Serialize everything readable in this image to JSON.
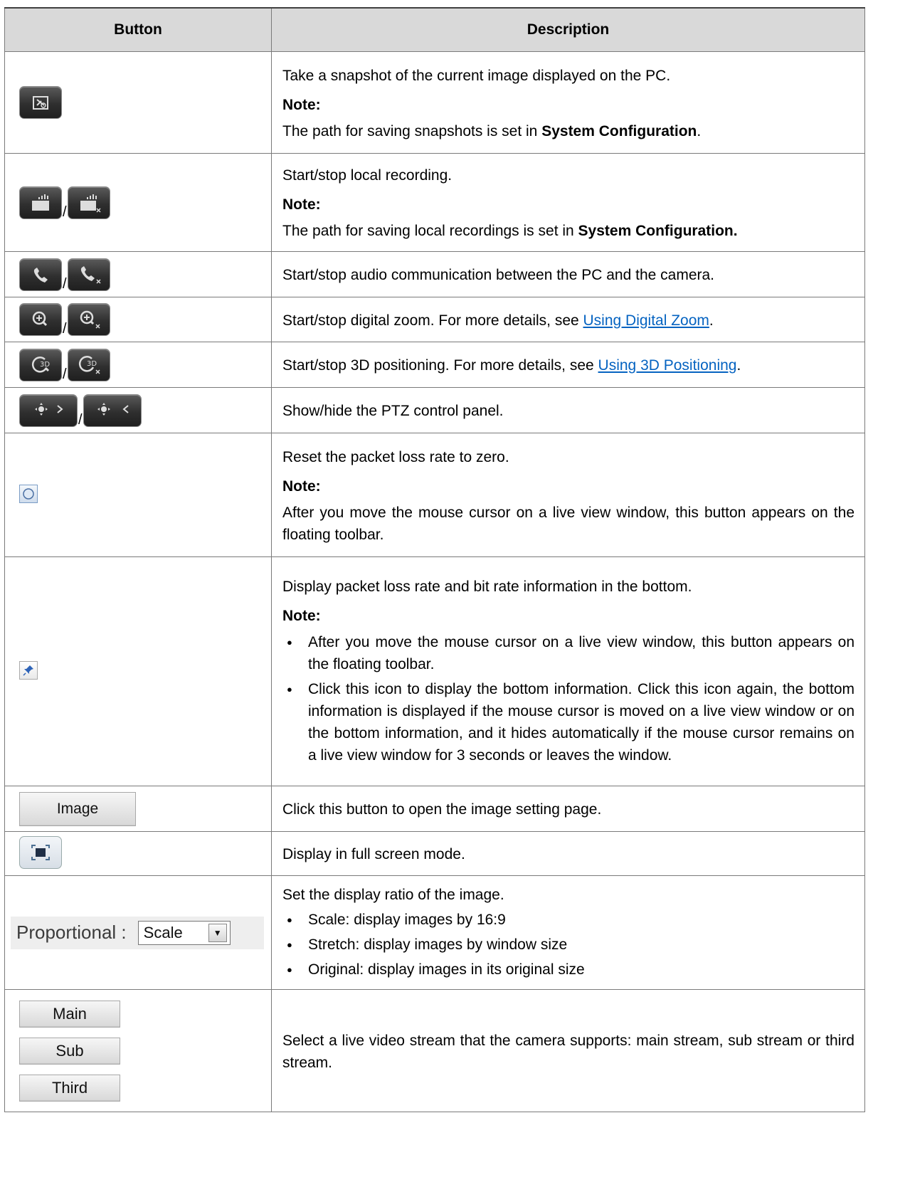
{
  "table": {
    "header": {
      "button": "Button",
      "description": "Description"
    },
    "note_label": "Note:",
    "rows": {
      "snapshot": {
        "icon": "snapshot-icon",
        "text": "Take a snapshot of the current image displayed on the PC.",
        "note_prefix": "The path for saving snapshots is set in ",
        "note_bold": "System Configuration",
        "note_suffix": "."
      },
      "recording": {
        "icons": [
          "record-start-icon",
          "record-stop-icon"
        ],
        "sep": "/",
        "text": "Start/stop local recording.",
        "note_prefix": "The path for saving local recordings is set in ",
        "note_bold": "System Configuration."
      },
      "audio": {
        "icons": [
          "audio-start-icon",
          "audio-stop-icon"
        ],
        "sep": "/",
        "text": "Start/stop audio communication between the PC and the camera."
      },
      "zoom": {
        "icons": [
          "zoom-start-icon",
          "zoom-stop-icon"
        ],
        "sep": "/",
        "text": "Start/stop digital zoom. For more details, see ",
        "link": "Using Digital Zoom",
        "suffix": "."
      },
      "positioning": {
        "icons": [
          "3d-position-start-icon",
          "3d-position-stop-icon"
        ],
        "sep": "/",
        "icon_text": "3D",
        "text": "Start/stop 3D positioning. For more details, see ",
        "link": "Using 3D Positioning",
        "suffix": "."
      },
      "ptz": {
        "icons": [
          "ptz-show-icon",
          "ptz-hide-icon"
        ],
        "sep": "/",
        "text": "Show/hide the PTZ control panel."
      },
      "reset": {
        "icon": "reset-circle-icon",
        "text": "Reset the packet loss rate to zero.",
        "note": "After you move the mouse cursor on a live view window, this button appears on the floating toolbar."
      },
      "pin": {
        "icon": "pin-icon",
        "text": "Display packet loss rate and bit rate information in the bottom.",
        "bullets": [
          "After you move the mouse cursor on a live view window, this button appears on the floating toolbar.",
          "Click this icon to display the bottom information. Click this icon again, the bottom information is displayed if the mouse cursor is moved on a live view window or on the bottom information, and it hides automatically if the mouse cursor remains on a live view window for 3 seconds or leaves the window."
        ]
      },
      "image": {
        "button_label": "Image",
        "text": "Click this button to open the image setting page."
      },
      "fullscreen": {
        "icon": "fullscreen-icon",
        "text": "Display in full screen mode."
      },
      "ratio": {
        "label": "Proportional :",
        "selected": "Scale",
        "text": "Set the display ratio of the image.",
        "bullets": [
          "Scale: display images by 16:9",
          "Stretch: display images by window size",
          "Original: display images in its original size"
        ]
      },
      "stream": {
        "buttons": [
          "Main",
          "Sub",
          "Third"
        ],
        "text": "Select a live video stream that the camera supports: main stream, sub stream or third stream."
      }
    }
  }
}
